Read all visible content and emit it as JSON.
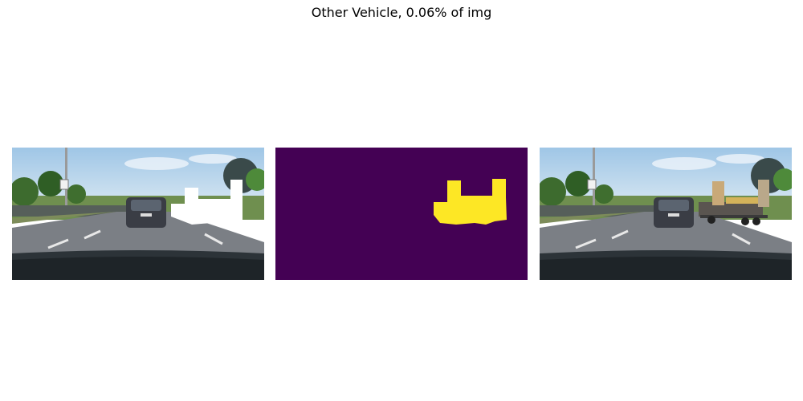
{
  "figure": {
    "title": "Other Vehicle, 0.06% of img"
  },
  "panels": [
    {
      "content": "road-scene-with-masked-vehicle"
    },
    {
      "content": "segmentation-mask"
    },
    {
      "content": "road-scene-original"
    }
  ],
  "colors": {
    "mask_background": "#440154",
    "mask_foreground": "#fde725",
    "mask_overlay": "#ffffff",
    "sky": "#bcd7ec",
    "road": "#7b7f85"
  }
}
